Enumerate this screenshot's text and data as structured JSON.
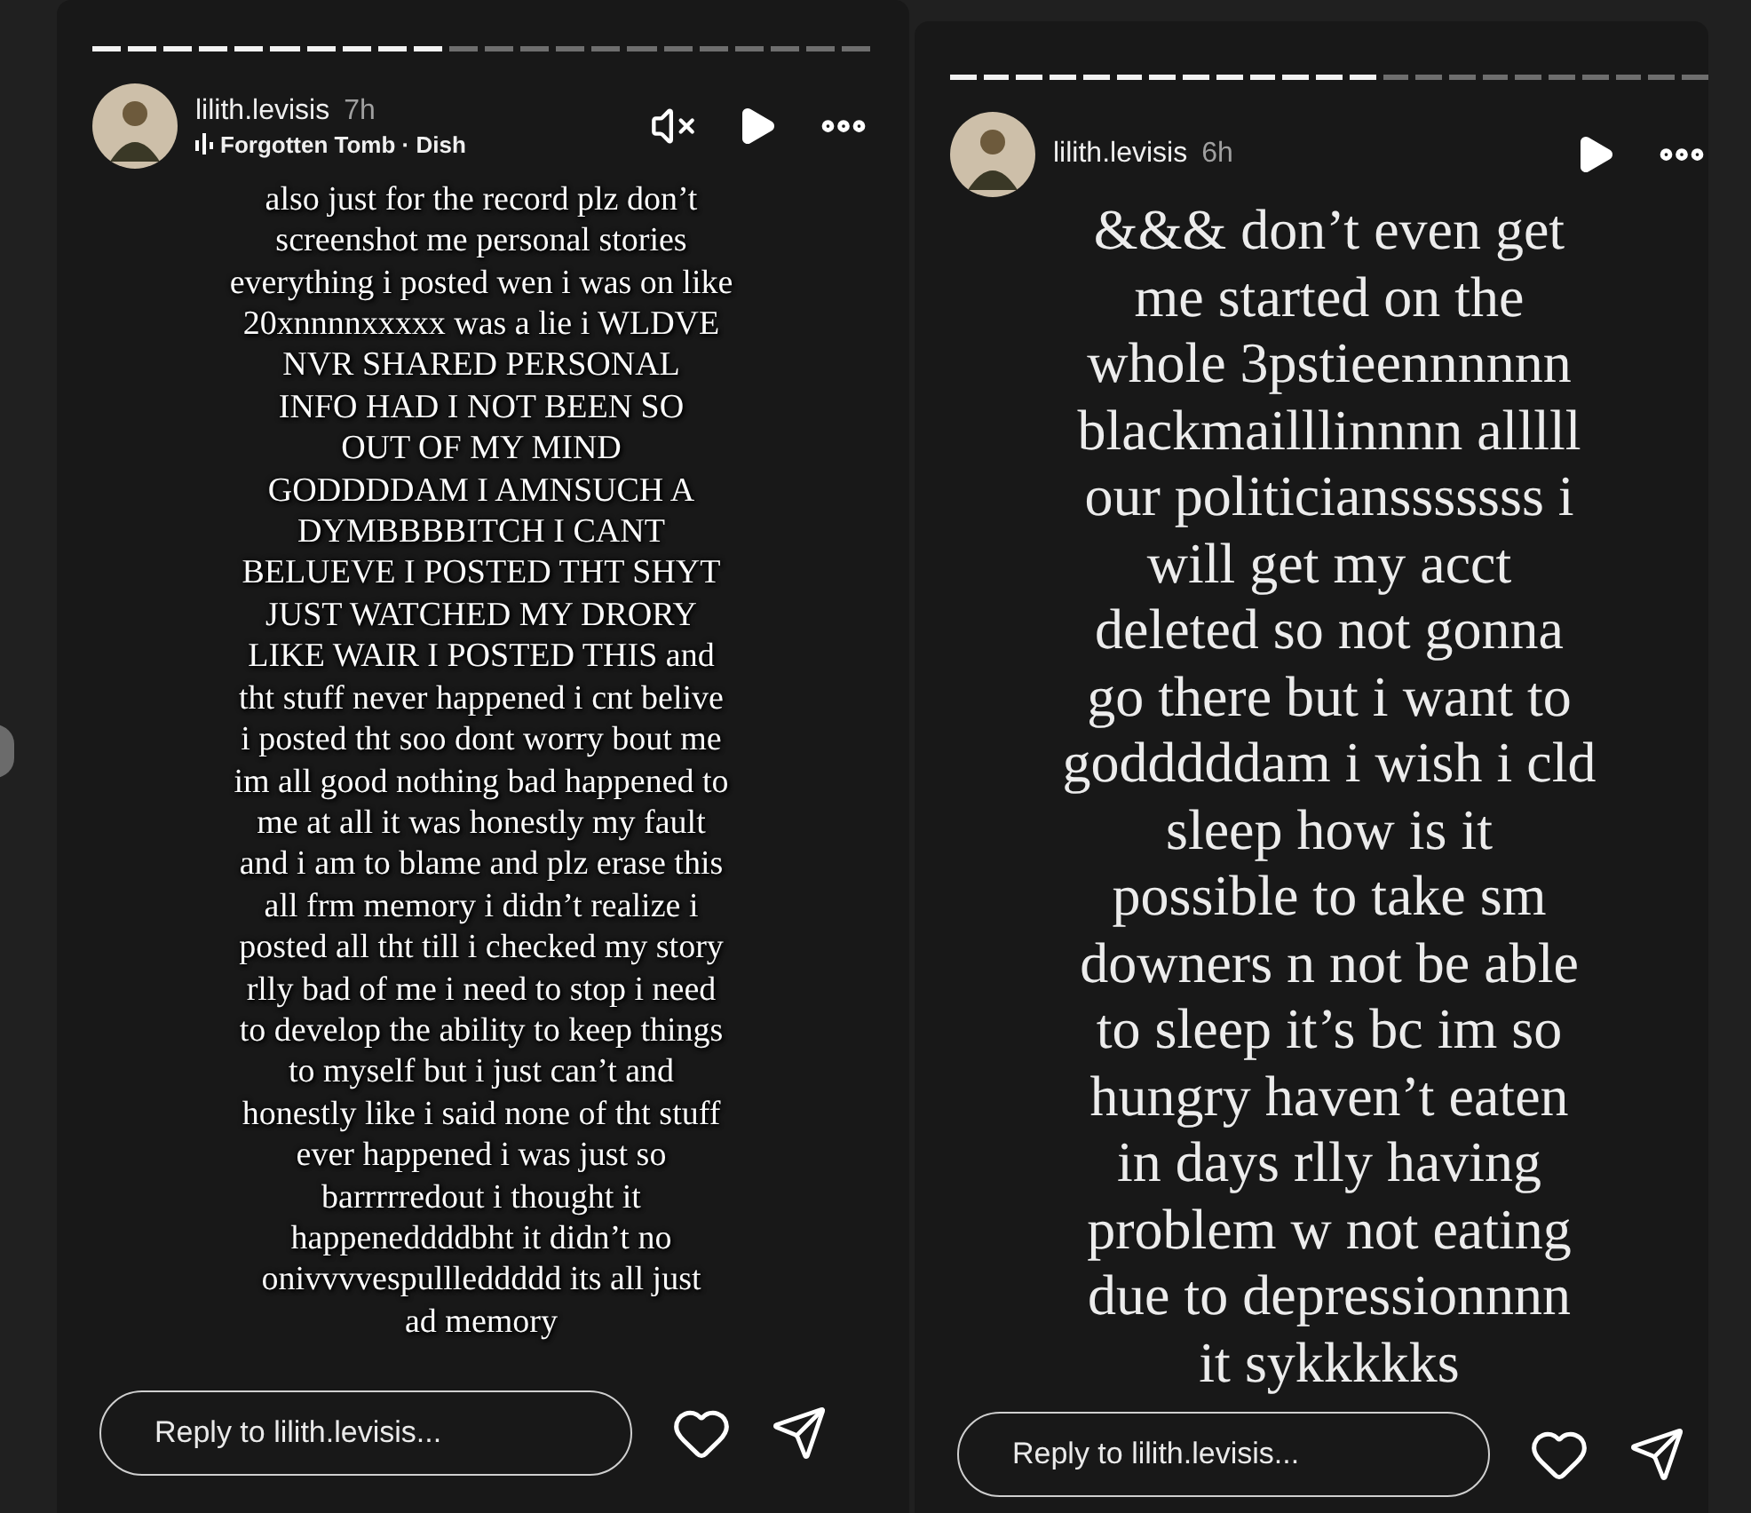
{
  "stories": [
    {
      "progress": [
        {
          "viewed": true
        },
        {
          "viewed": true
        },
        {
          "viewed": true
        },
        {
          "viewed": true
        },
        {
          "viewed": true
        },
        {
          "viewed": true
        },
        {
          "viewed": true
        },
        {
          "viewed": true
        },
        {
          "viewed": true
        },
        {
          "viewed": true
        },
        {
          "viewed": false
        },
        {
          "viewed": false
        },
        {
          "viewed": false
        },
        {
          "viewed": false
        },
        {
          "viewed": false
        },
        {
          "viewed": false
        },
        {
          "viewed": false
        },
        {
          "viewed": false
        },
        {
          "viewed": false
        },
        {
          "viewed": false
        },
        {
          "viewed": false
        },
        {
          "viewed": false
        }
      ],
      "username": "lilith.levisis",
      "time": "7h",
      "music": "Forgotten Tomb · Dish",
      "muted": true,
      "kind": "shadowed",
      "lines": [
        "also just for the record plz don’t",
        "screenshot me personal stories",
        "everything i posted wen i was on like",
        "20xnnnnxxxxx was a lie i WLDVE",
        "NVR SHARED PERSONAL",
        "INFO HAD I NOT BEEN SO",
        "OUT OF MY MIND",
        "GODDDDAM I AMNSUCH A",
        "DYMBBBBITCH I CANT",
        "BELUEVE I POSTED THT SHYT",
        "JUST WATCHED MY DRORY",
        "LIKE WAIR I POSTED THIS and",
        "tht stuff never happened i cnt belive",
        "i posted tht soo dont worry bout me",
        "im all good nothing bad happened to",
        "me at all it was honestly my fault",
        "and i am to blame and plz erase this",
        "all frm memory i didn’t realize i",
        "posted all tht till i checked my story",
        "rlly bad of me i need to stop i need",
        "to develop the ability to keep things",
        "to myself but i just can’t and",
        "honestly like i said none of tht stuff",
        "ever happened i was just so",
        "barrrrredout i thought it",
        "happeneddddbht it didn’t no",
        "onivvvvespullleddddd its all just",
        "ad memory"
      ],
      "reply_placeholder": "Reply to lilith.levisis..."
    },
    {
      "progress": [
        {
          "viewed": true
        },
        {
          "viewed": true
        },
        {
          "viewed": true
        },
        {
          "viewed": true
        },
        {
          "viewed": true
        },
        {
          "viewed": true
        },
        {
          "viewed": true
        },
        {
          "viewed": true
        },
        {
          "viewed": true
        },
        {
          "viewed": true
        },
        {
          "viewed": true
        },
        {
          "viewed": true
        },
        {
          "viewed": true
        },
        {
          "viewed": false
        },
        {
          "viewed": false
        },
        {
          "viewed": false
        },
        {
          "viewed": false
        },
        {
          "viewed": false
        },
        {
          "viewed": false
        },
        {
          "viewed": false
        },
        {
          "viewed": false
        },
        {
          "viewed": false
        },
        {
          "viewed": false
        }
      ],
      "username": "lilith.levisis",
      "time": "6h",
      "kind": "plain",
      "lines": [
        "&&& don’t even get",
        "me started on the",
        "whole 3pstieennnnnn",
        "blackmailllinnnn alllll",
        "our politiciansssssss i",
        "will get my acct",
        "deleted so not gonna",
        "go there but i want to",
        "godddddam i wish i cld",
        "sleep how is it",
        "possible to take sm",
        "downers n not be able",
        "to sleep it’s bc im so",
        "hungry haven’t eaten",
        "in days rlly having",
        "problem w not eating",
        "due to depressionnnn",
        "it sykkkkks"
      ],
      "reply_placeholder": "Reply to lilith.levisis..."
    }
  ]
}
